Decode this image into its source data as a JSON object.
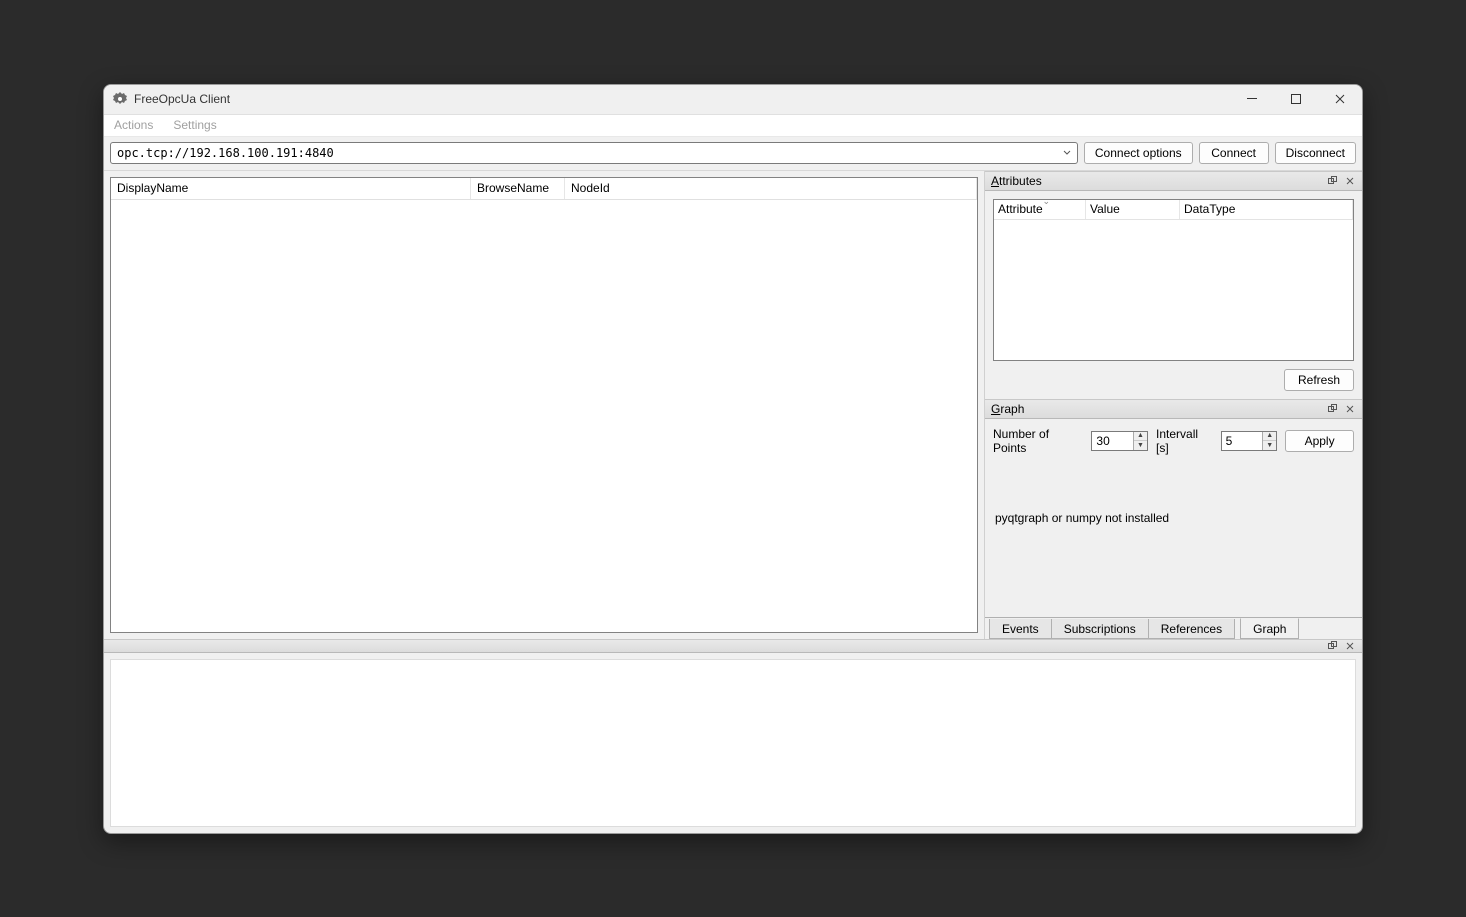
{
  "titlebar": {
    "title": "FreeOpcUa Client"
  },
  "menubar": {
    "actions": "Actions",
    "settings": "Settings"
  },
  "toolbar": {
    "address": "opc.tcp://192.168.100.191:4840",
    "connect_options": "Connect options",
    "connect": "Connect",
    "disconnect": "Disconnect"
  },
  "tree": {
    "headers": {
      "display_name": "DisplayName",
      "browse_name": "BrowseName",
      "node_id": "NodeId"
    }
  },
  "attributes": {
    "title_prefix": "A",
    "title_rest": "ttributes",
    "headers": {
      "attribute": "Attribute",
      "value": "Value",
      "data_type": "DataType"
    },
    "refresh": "Refresh"
  },
  "graph": {
    "title_prefix": "G",
    "title_rest": "raph",
    "num_points_label": "Number of Points",
    "num_points_value": "30",
    "interval_label": "Intervall [s]",
    "interval_value": "5",
    "apply": "Apply",
    "message": "pyqtgraph or numpy not installed"
  },
  "tabs": {
    "events": "Events",
    "subscriptions": "Subscriptions",
    "references": "References",
    "graph": "Graph"
  }
}
